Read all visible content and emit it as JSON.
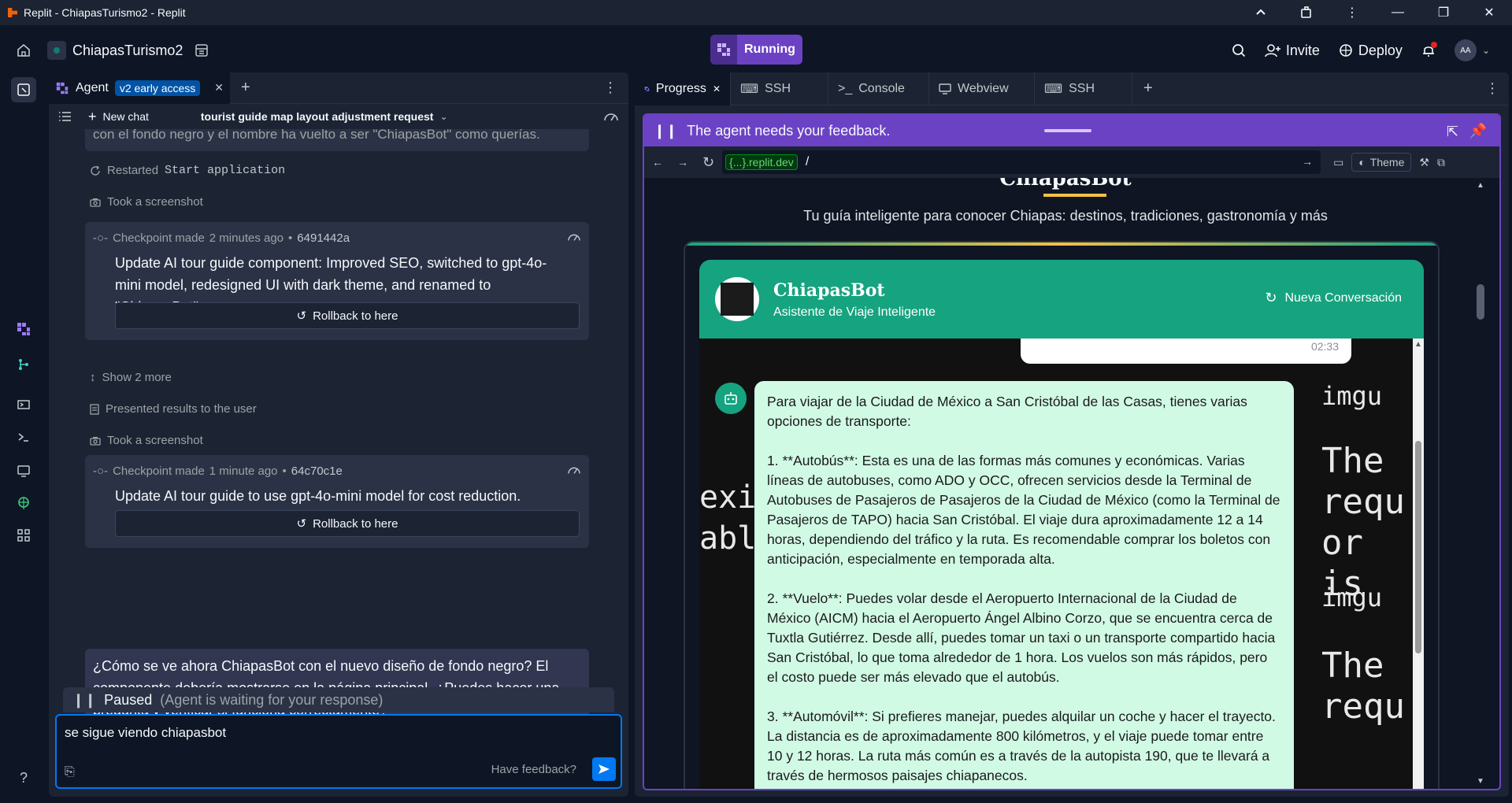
{
  "window": {
    "title": "Replit - ChiapasTurismo2 - Replit"
  },
  "header": {
    "project_name": "ChiapasTurismo2",
    "run_status": "Running",
    "invite_label": "Invite",
    "deploy_label": "Deploy",
    "avatar_initials": "AA"
  },
  "agent": {
    "tab_label": "Agent",
    "badge": "v2 early access",
    "new_chat_label": "New chat",
    "chat_title": "tourist guide map layout adjustment request",
    "truncated_text": "con el fondo negro y el nombre ha vuelto a ser \"ChiapasBot\" como querías.",
    "restarted_label": "Restarted",
    "restarted_target": "Start application",
    "screenshot_label": "Took a screenshot",
    "checkpoints": [
      {
        "label": "Checkpoint made",
        "time": "2 minutes ago",
        "hash": "6491442a",
        "body": "Update AI tour guide component: Improved SEO, switched to gpt-4o-mini model, redesigned UI with dark theme, and renamed to \"ChiapasBot\".",
        "rollback": "Rollback to here"
      },
      {
        "label": "Checkpoint made",
        "time": "1 minute ago",
        "hash": "64c70c1e",
        "body": "Update AI tour guide to use gpt-4o-mini model for cost reduction.",
        "rollback": "Rollback to here"
      }
    ],
    "show_more": "Show 2 more",
    "presented": "Presented results to the user",
    "screenshot_label_2": "Took a screenshot",
    "user_message": "¿Cómo se ve ahora ChiapasBot con el nuevo diseño de fondo negro? El componente debería mostrarse en la página principal. ¿Puedes hacer una pregunta y verificar si funciona correctamente?",
    "paused_label": "Paused",
    "paused_detail": "(Agent is waiting for your response)",
    "input_value": "se sigue viendo chiapasbot",
    "feedback_label": "Have feedback?"
  },
  "right_panel": {
    "tabs": [
      {
        "label": "Progress",
        "icon": "progress-icon"
      },
      {
        "label": "SSH",
        "icon": "terminal-icon"
      },
      {
        "label": "Console",
        "icon": "console-icon"
      },
      {
        "label": "Webview",
        "icon": "monitor-icon"
      },
      {
        "label": "SSH",
        "icon": "terminal-icon"
      }
    ],
    "feedback_banner": "The agent needs your feedback.",
    "url_host": "{...}.replit.dev",
    "url_path": "/",
    "theme_label": "Theme"
  },
  "site": {
    "title": "ChiapasBot",
    "subtitle": "Tu guía inteligente para conocer Chiapas: destinos, tradiciones, gastronomía y más",
    "bot_name": "ChiapasBot",
    "bot_tagline": "Asistente de Viaje Inteligente",
    "new_conversation": "Nueva Conversación",
    "prev_time": "02:33",
    "bot_message": [
      "Para viajar de la Ciudad de México a San Cristóbal de las Casas, tienes varias opciones de transporte:",
      "1. **Autobús**: Esta es una de las formas más comunes y económicas. Varias líneas de autobuses, como ADO y OCC, ofrecen servicios desde la Terminal de Autobuses de Pasajeros de Pasajeros de la Ciudad de México (como la Terminal de Pasajeros de TAPO) hacia San Cristóbal. El viaje dura aproximadamente 12 a 14 horas, dependiendo del tráfico y la ruta. Es recomendable comprar los boletos con anticipación, especialmente en temporada alta.",
      "2. **Vuelo**: Puedes volar desde el Aeropuerto Internacional de la Ciudad de México (AICM) hacia el Aeropuerto Ángel Albino Corzo, que se encuentra cerca de Tuxtla Gutiérrez. Desde allí, puedes tomar un taxi o un transporte compartido hacia San Cristóbal, lo que toma alrededor de 1 hora. Los vuelos son más rápidos, pero el costo puede ser más elevado que el autobús.",
      "3. **Automóvil**: Si prefieres manejar, puedes alquilar un coche y hacer el trayecto. La distancia es de aproximadamente 800 kilómetros, y el viaje puede tomar entre 10 y 12 horas. La ruta más común es a través de la autopista 190, que te llevará a través de hermosos paisajes chiapanecos."
    ]
  },
  "colors": {
    "accent": "#6c42c5",
    "primary_blue": "#0079f2",
    "bot_green": "#16a37f"
  }
}
